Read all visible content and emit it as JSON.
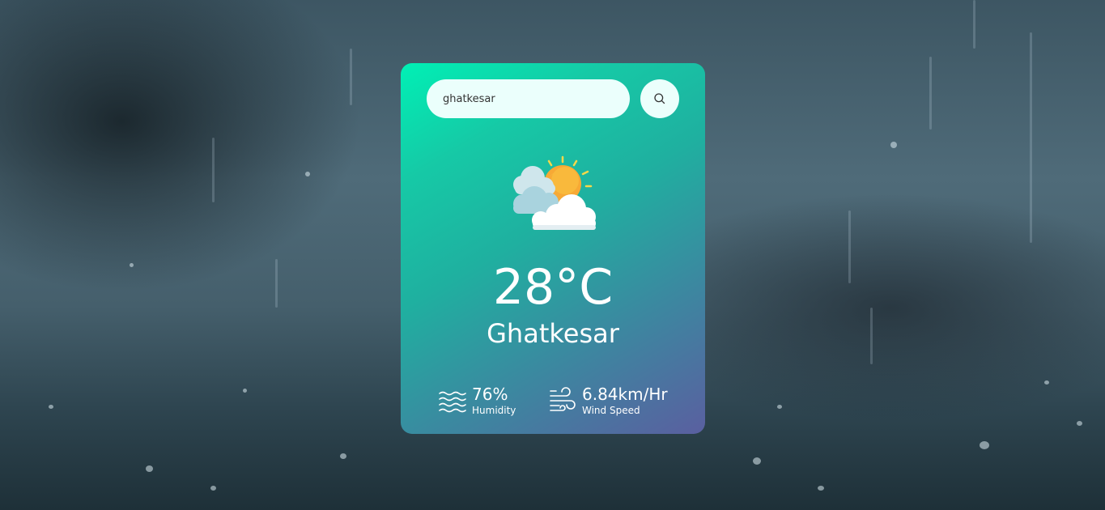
{
  "search": {
    "value": "ghatkesar",
    "placeholder": "Enter city name"
  },
  "weather": {
    "icon": "partly-cloudy-icon",
    "temperature": "28°C",
    "city": "Ghatkesar"
  },
  "stats": {
    "humidity": {
      "icon": "humidity-waves-icon",
      "value": "76%",
      "label": "Humidity"
    },
    "wind": {
      "icon": "wind-icon",
      "value": "6.84km/Hr",
      "label": "Wind Speed"
    }
  },
  "colors": {
    "card_gradient_start": "#00f0b5",
    "card_gradient_end": "#5a5fa0",
    "input_background": "#ebfffc",
    "text": "#ffffff"
  }
}
